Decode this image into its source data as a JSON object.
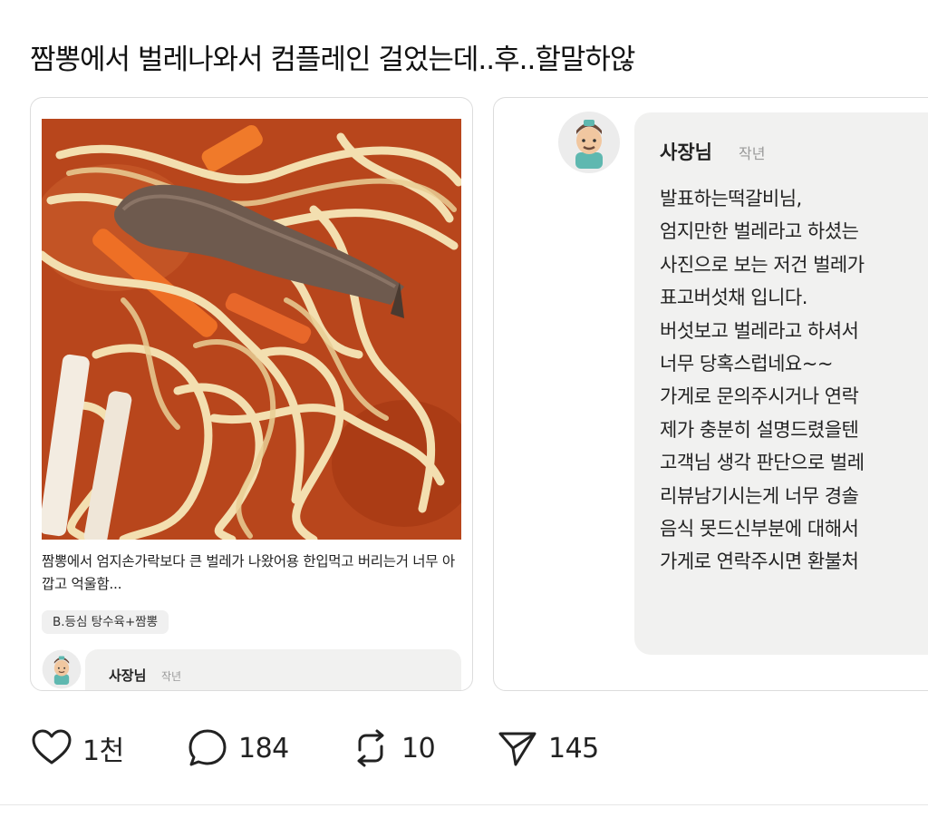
{
  "post": {
    "title": "짬뽕에서 벌레나와서 컴플레인 걸었는데..후..할말하않"
  },
  "review_card": {
    "text": "짬뽕에서 엄지손가락보다 큰 벌레가 나왔어용 한입먹고 버리는거 너무 아깝고 억울함...",
    "menu_chip": "B.등심 탕수육+짬뽕",
    "reply_preview": {
      "name": "사장님",
      "time": "작년"
    },
    "photo_icon": "jjamppong-photo"
  },
  "owner_reply": {
    "name": "사장님",
    "time": "작년",
    "lines": [
      "발표하는떡갈비님,",
      "엄지만한 벌레라고 하셨는",
      "사진으로 보는 저건 벌레가",
      "표고버섯채 입니다.",
      "버섯보고 벌레라고 하셔서",
      "너무 당혹스럽네요~~",
      "가게로 문의주시거나 연락",
      "제가 충분히 설명드렸을텐",
      "고객님 생각 판단으로 벌레",
      "리뷰남기시는게 너무 경솔",
      "음식 못드신부분에 대해서",
      "가게로 연락주시면 환불처"
    ]
  },
  "actions": {
    "like": {
      "icon": "heart-icon",
      "count": "1천"
    },
    "comment": {
      "icon": "comment-icon",
      "count": "184"
    },
    "repost": {
      "icon": "repost-icon",
      "count": "10"
    },
    "share": {
      "icon": "send-icon",
      "count": "145"
    }
  },
  "colors": {
    "bubble": "#f1f1f0",
    "border": "#dcdcdc",
    "text": "#222222"
  }
}
